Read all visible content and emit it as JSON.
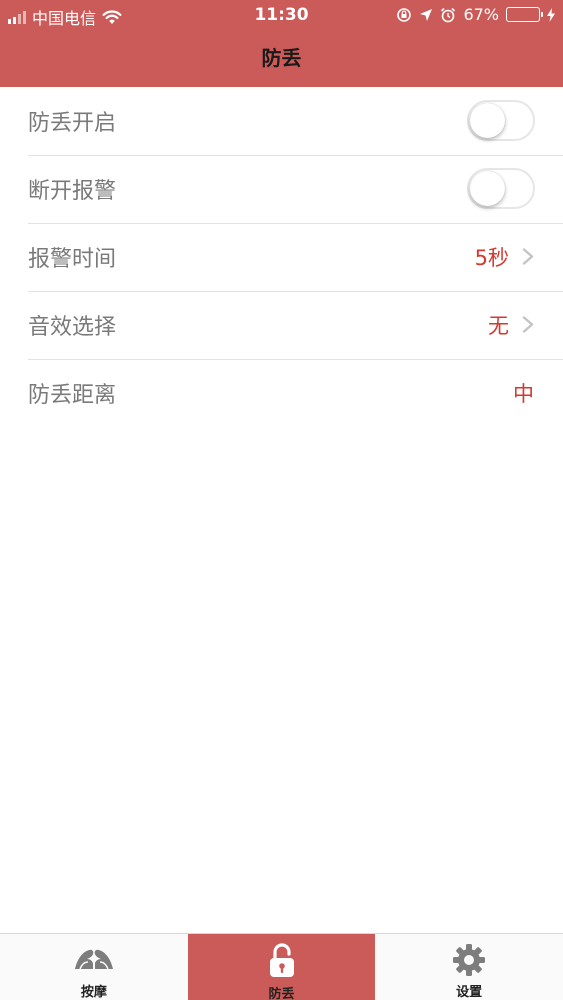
{
  "status_bar": {
    "carrier": "中国电信",
    "time": "11:30",
    "battery": "67%",
    "battery_level": 0.67
  },
  "nav": {
    "title": "防丢"
  },
  "settings": {
    "anti_loss_enable": {
      "label": "防丢开启",
      "on": false
    },
    "disconnect_alarm": {
      "label": "断开报警",
      "on": false
    },
    "alarm_time": {
      "label": "报警时间",
      "value": "5秒"
    },
    "sound_select": {
      "label": "音效选择",
      "value": "无"
    },
    "anti_loss_distance": {
      "label": "防丢距离",
      "value": "中"
    }
  },
  "tabbar": {
    "active": "anti-loss",
    "items": [
      {
        "label": "按摩",
        "icon": "massage-hands-icon"
      },
      {
        "label": "防丢",
        "icon": "lock-open-icon"
      },
      {
        "label": "设置",
        "icon": "gear-icon"
      }
    ]
  },
  "colors": {
    "brand": "#cb5b59",
    "value_red": "#d33a2f",
    "label_gray": "#7a7a7a",
    "battery_green": "#6fd35c"
  }
}
